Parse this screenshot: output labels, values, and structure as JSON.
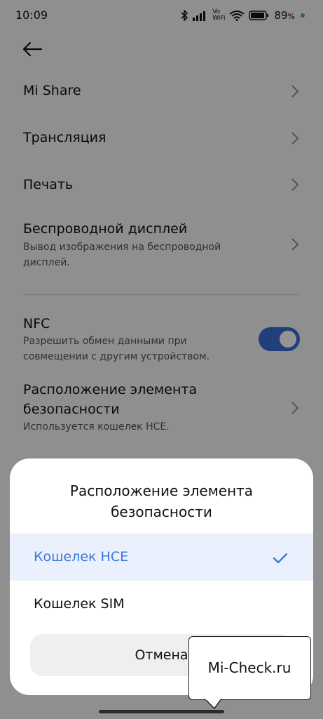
{
  "status_bar": {
    "time": "10:09",
    "vo_label": "Vo",
    "wifi_label": "WiFi",
    "battery": "89",
    "battery_unit": "%",
    "icons": [
      "bluetooth-icon",
      "signal-icon",
      "vowifi-icon",
      "wifi-icon",
      "battery-icon"
    ],
    "charge_color": "#35c759"
  },
  "nav": {
    "back_icon": "back-arrow-icon"
  },
  "settings": {
    "items": [
      {
        "title": "Mi Share"
      },
      {
        "title": "Трансляция"
      },
      {
        "title": "Печать"
      },
      {
        "title": "Беспроводной дисплей",
        "subtitle_lines": [
          "Вывод изображения на беспроводной",
          "дисплей."
        ]
      },
      {
        "title": "NFC",
        "subtitle_lines": [
          "Разрешить обмен данными при",
          "совмещении с другим устройством."
        ],
        "toggle_on": true
      },
      {
        "title_lines": [
          "Расположение элемента",
          "безопасности"
        ],
        "subtitle": "Используется кошелек HCE."
      }
    ]
  },
  "dialog": {
    "title_lines": [
      "Расположение элемента",
      "безопасности"
    ],
    "options": [
      {
        "label": "Кошелек HCE",
        "selected": true
      },
      {
        "label": "Кошелек SIM",
        "selected": false
      }
    ],
    "cancel": "Отмена"
  },
  "watermark": {
    "text": "Mi-Check.ru"
  },
  "colors": {
    "accent": "#3d78d8",
    "toggle": "#3a6fd4",
    "selected_bg": "#eaf0fd"
  }
}
